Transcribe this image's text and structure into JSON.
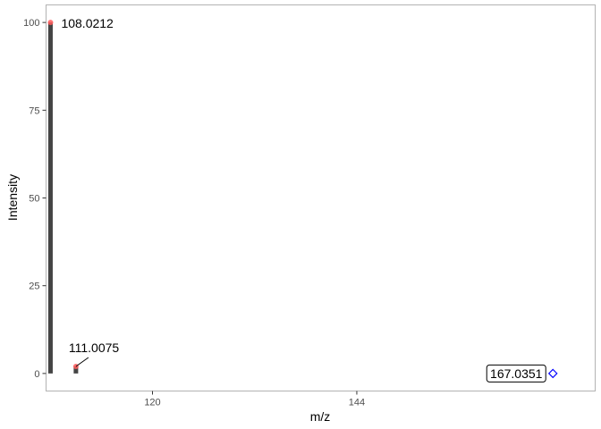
{
  "chart_data": {
    "type": "bar",
    "xlabel": "m/z",
    "ylabel": "Intensity",
    "xlim": [
      107.5,
      172.0
    ],
    "ylim": [
      -5,
      105
    ],
    "x_ticks": [
      120,
      144
    ],
    "y_ticks": [
      0,
      25,
      50,
      75,
      100
    ],
    "grid": false,
    "series": [
      {
        "peaks": [
          {
            "mz": 108.0212,
            "intensity": 100,
            "label": "108.0212"
          },
          {
            "mz": 111.0075,
            "intensity": 2,
            "label": "111.0075"
          }
        ]
      }
    ],
    "precursor": {
      "mz": 167.0351,
      "intensity": 0,
      "label": "167.0351"
    },
    "colors": {
      "bar": "#444444",
      "peak_point": "#ff5a5a",
      "precursor_marker": "#0000ff",
      "frame": "#b3b3b3"
    }
  }
}
